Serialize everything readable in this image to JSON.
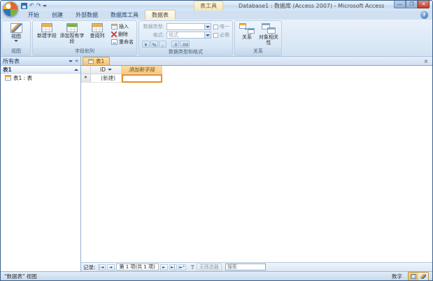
{
  "colors": {
    "selection_border": "#e89225",
    "active_doc_tab": "#f4bf70",
    "titlebar_blue": "#d8e7f7",
    "contextual_amber": "#f4e6bd"
  },
  "titlebar": {
    "contextual_group": "表工具",
    "title": "Database1 : 数据库 (Access 2007) - Microsoft Access"
  },
  "icons": {
    "undo": "↶",
    "redo": "↷",
    "minimize": "—",
    "maximize": "❐",
    "close": "✕",
    "help": "?",
    "doc_close": "×",
    "nav_collapse": "«",
    "record_first": "|◄",
    "record_prev": "◄",
    "record_next": "►",
    "record_last": "►|",
    "record_new": "►*"
  },
  "ribbon": {
    "tabs": [
      {
        "label": "开始"
      },
      {
        "label": "创建"
      },
      {
        "label": "外部数据"
      },
      {
        "label": "数据库工具"
      },
      {
        "label": "数据表"
      }
    ],
    "views": {
      "label": "视图",
      "button": "视图"
    },
    "fields": {
      "label": "字段和列",
      "new_field": "新建字段",
      "add_existing": "添加现有字段",
      "lookup": "查阅列",
      "insert": "插入",
      "del": "删除",
      "rename": "重命名"
    },
    "format": {
      "label": "数据类型和格式",
      "datatype": "数据类型:",
      "format_label": "格式:",
      "format_value": "格式",
      "unique": "唯一",
      "required": "必需",
      "btn_currency": "¥",
      "btn_percent": "%",
      "btn_comma": ",",
      "btn_inc": ".0",
      "btn_dec": ".00"
    },
    "relations": {
      "label": "关系",
      "relationships": "关系",
      "dependencies": "对象相关性"
    }
  },
  "nav": {
    "header": "所有表",
    "group": "表1",
    "item": "表1 : 表"
  },
  "doc": {
    "tab": "表1",
    "grid": {
      "id_header": "ID",
      "new_field_header": "添加新字段",
      "new_record": "(新建)",
      "selector": "*"
    },
    "recnav": {
      "label": "记录:",
      "position": "第 1 项(共 1 项)",
      "no_filter": "无筛选器",
      "search_placeholder": "搜索"
    }
  },
  "status": {
    "view": "\"数据表\" 视图",
    "numlock": "数字"
  }
}
